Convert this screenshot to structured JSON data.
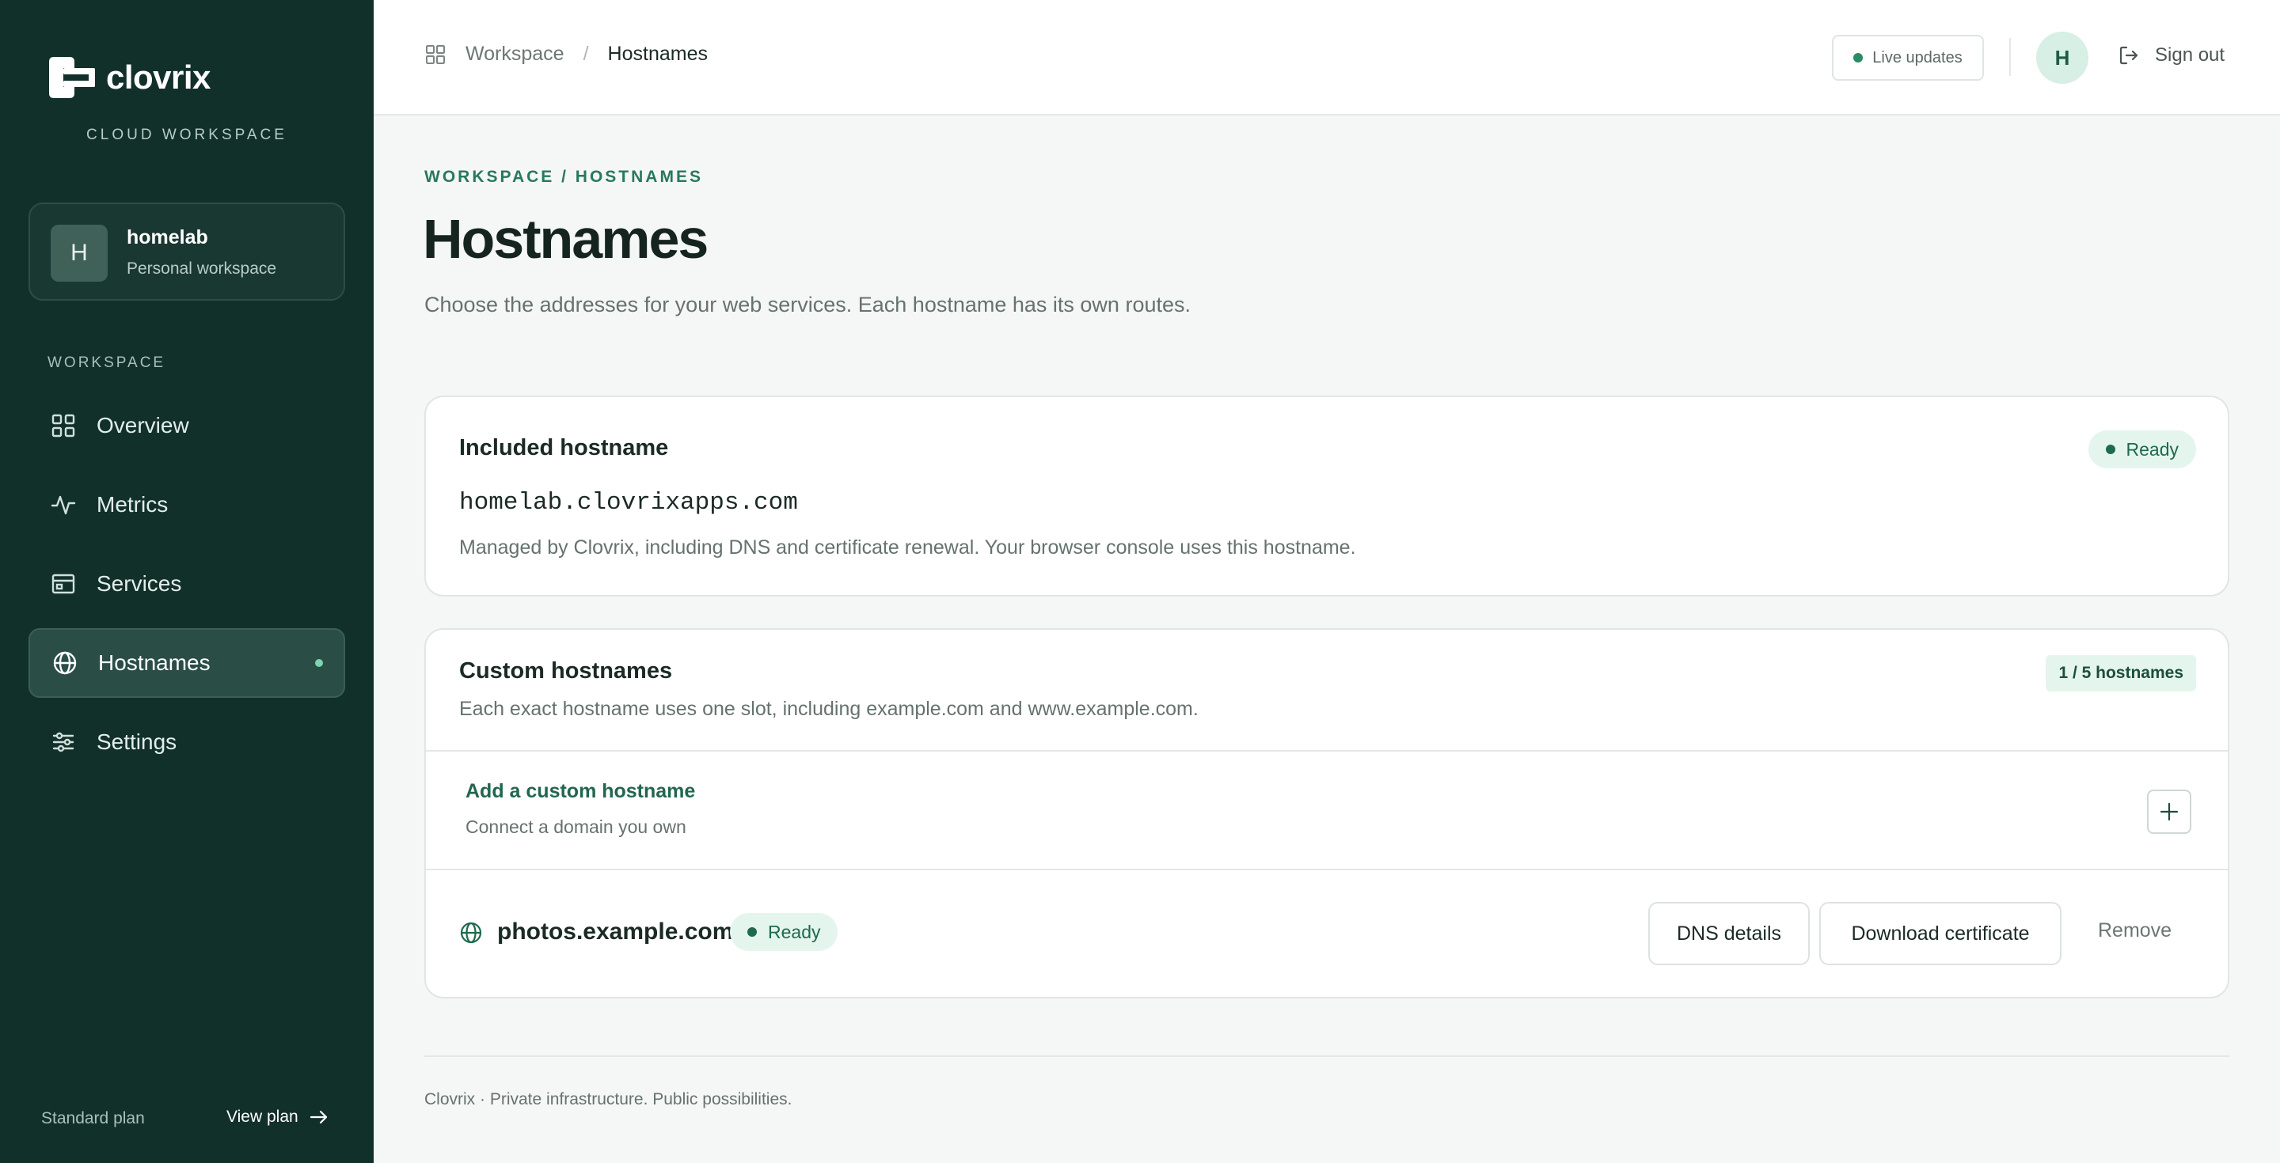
{
  "brand": {
    "name": "clovrix",
    "subtitle": "CLOUD WORKSPACE"
  },
  "workspace": {
    "avatar_letter": "H",
    "name": "homelab",
    "description": "Personal workspace"
  },
  "sidebar": {
    "section_label": "WORKSPACE",
    "items": [
      {
        "label": "Overview",
        "icon": "grid-icon",
        "active": false
      },
      {
        "label": "Metrics",
        "icon": "activity-icon",
        "active": false
      },
      {
        "label": "Services",
        "icon": "window-icon",
        "active": false
      },
      {
        "label": "Hostnames",
        "icon": "globe-icon",
        "active": true
      },
      {
        "label": "Settings",
        "icon": "sliders-icon",
        "active": false
      }
    ],
    "footer": {
      "plan": "Standard plan",
      "view_plan": "View plan"
    }
  },
  "header": {
    "breadcrumb": {
      "parent": "Workspace",
      "separator": "/",
      "current": "Hostnames"
    },
    "live_updates": "Live updates",
    "user_initial": "H",
    "sign_out": "Sign out"
  },
  "page": {
    "eyebrow": "WORKSPACE / HOSTNAMES",
    "title": "Hostnames",
    "subtitle": "Choose the addresses for your web services. Each hostname has its own routes."
  },
  "included": {
    "title": "Included hostname",
    "status": "Ready",
    "hostname": "homelab.clovrixapps.com",
    "description": "Managed by Clovrix, including DNS and certificate renewal. Your browser console uses this hostname."
  },
  "custom": {
    "title": "Custom hostnames",
    "count_badge": "1 / 5 hostnames",
    "description": "Each exact hostname uses one slot, including example.com and www.example.com.",
    "add_title": "Add a custom hostname",
    "add_description": "Connect a domain you own",
    "hosts": [
      {
        "name": "photos.example.com",
        "status": "Ready",
        "dns_label": "DNS details",
        "cert_label": "Download certificate",
        "remove_label": "Remove"
      }
    ]
  },
  "footer": {
    "text": "Clovrix · Private infrastructure. Public possibilities."
  },
  "colors": {
    "sidebar_bg": "#12302a",
    "accent": "#27795c",
    "ready_bg": "#e4f5ed"
  }
}
